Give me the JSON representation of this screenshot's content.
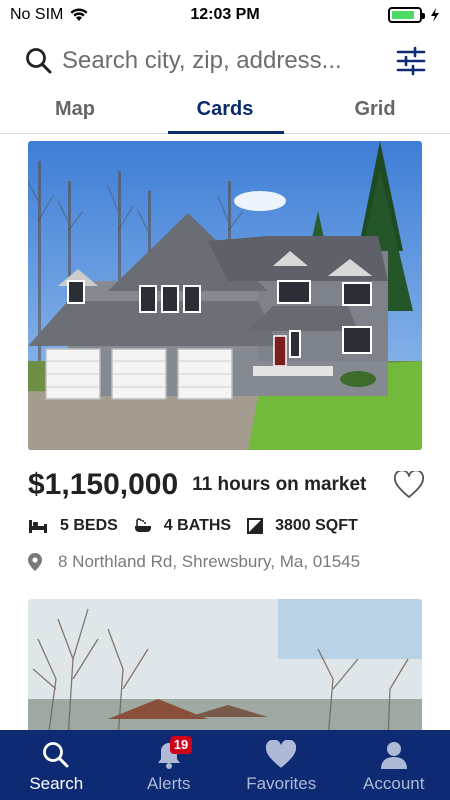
{
  "status_bar": {
    "carrier": "No SIM",
    "time": "12:03 PM",
    "battery_level": 0.85,
    "battery_color": "#4cd964"
  },
  "search": {
    "placeholder": "Search city, zip, address...",
    "value": "",
    "search_icon": "search-icon",
    "filter_icon": "filter-sliders-icon"
  },
  "tabs": [
    {
      "label": "Map",
      "active": false
    },
    {
      "label": "Cards",
      "active": true
    },
    {
      "label": "Grid",
      "active": false
    }
  ],
  "listings": [
    {
      "price": "$1,150,000",
      "time_on_market": "11 hours on market",
      "favorite_icon": "heart-outline-icon",
      "beds": "5 BEDS",
      "baths": "4 BATHS",
      "sqft": "3800 SQFT",
      "address": "8 Northland Rd, Shrewsbury, Ma, 01545"
    }
  ],
  "bottom_nav": [
    {
      "label": "Search",
      "icon": "search-icon",
      "active": true
    },
    {
      "label": "Alerts",
      "icon": "bell-icon",
      "badge": "19",
      "active": false
    },
    {
      "label": "Favorites",
      "icon": "heart-icon",
      "active": false
    },
    {
      "label": "Account",
      "icon": "user-icon",
      "active": false
    }
  ],
  "colors": {
    "brand": "#0d2a73",
    "tab_active": "#0a2a6e",
    "badge": "#d0021b"
  }
}
